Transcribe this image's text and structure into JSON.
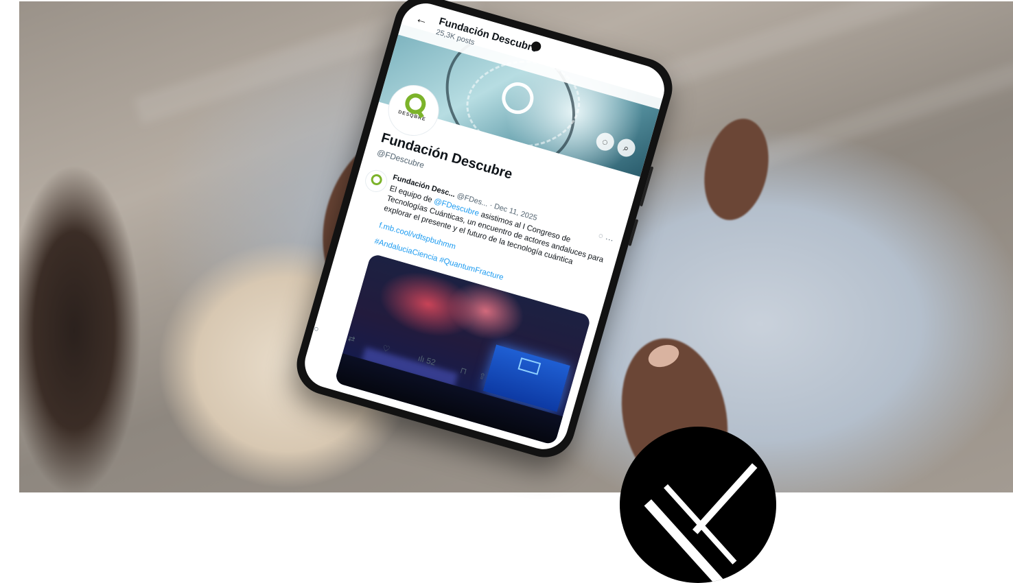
{
  "profile": {
    "topbar_title": "Fundación Descubre",
    "posts_count": "25,3K posts",
    "name": "Fundación Descubre",
    "handle": "@FDescubre",
    "avatar_logo_text": "DESQBRE"
  },
  "post": {
    "author": "Fundación Desc...",
    "handle_date": "@FDes... · Dec 11, 2025",
    "text_1": "El equipo de ",
    "mention": "@FDescubre",
    "text_2": " asistimos al I Congreso de Tecnologías Cuánticas, un encuentro de actores andaluces para explorar el presente y el futuro de la tecnología cuántica",
    "link": "f.mb.cool/vdtspbuhmm",
    "hashtags": "#AndaluciaCiencia #QuantumFracture",
    "views": "52"
  },
  "icons": {
    "back": "back-arrow-icon",
    "grok": "grok-icon",
    "search": "search-icon",
    "more": "more-icon",
    "reply": "reply-icon",
    "repost": "repost-icon",
    "like": "like-icon",
    "views": "views-icon",
    "bookmark": "bookmark-icon",
    "share": "share-icon",
    "x_logo": "x-logo-icon"
  },
  "colors": {
    "link": "#1d9bf0",
    "brand_green": "#7cb32a",
    "x_badge": "#000000"
  }
}
